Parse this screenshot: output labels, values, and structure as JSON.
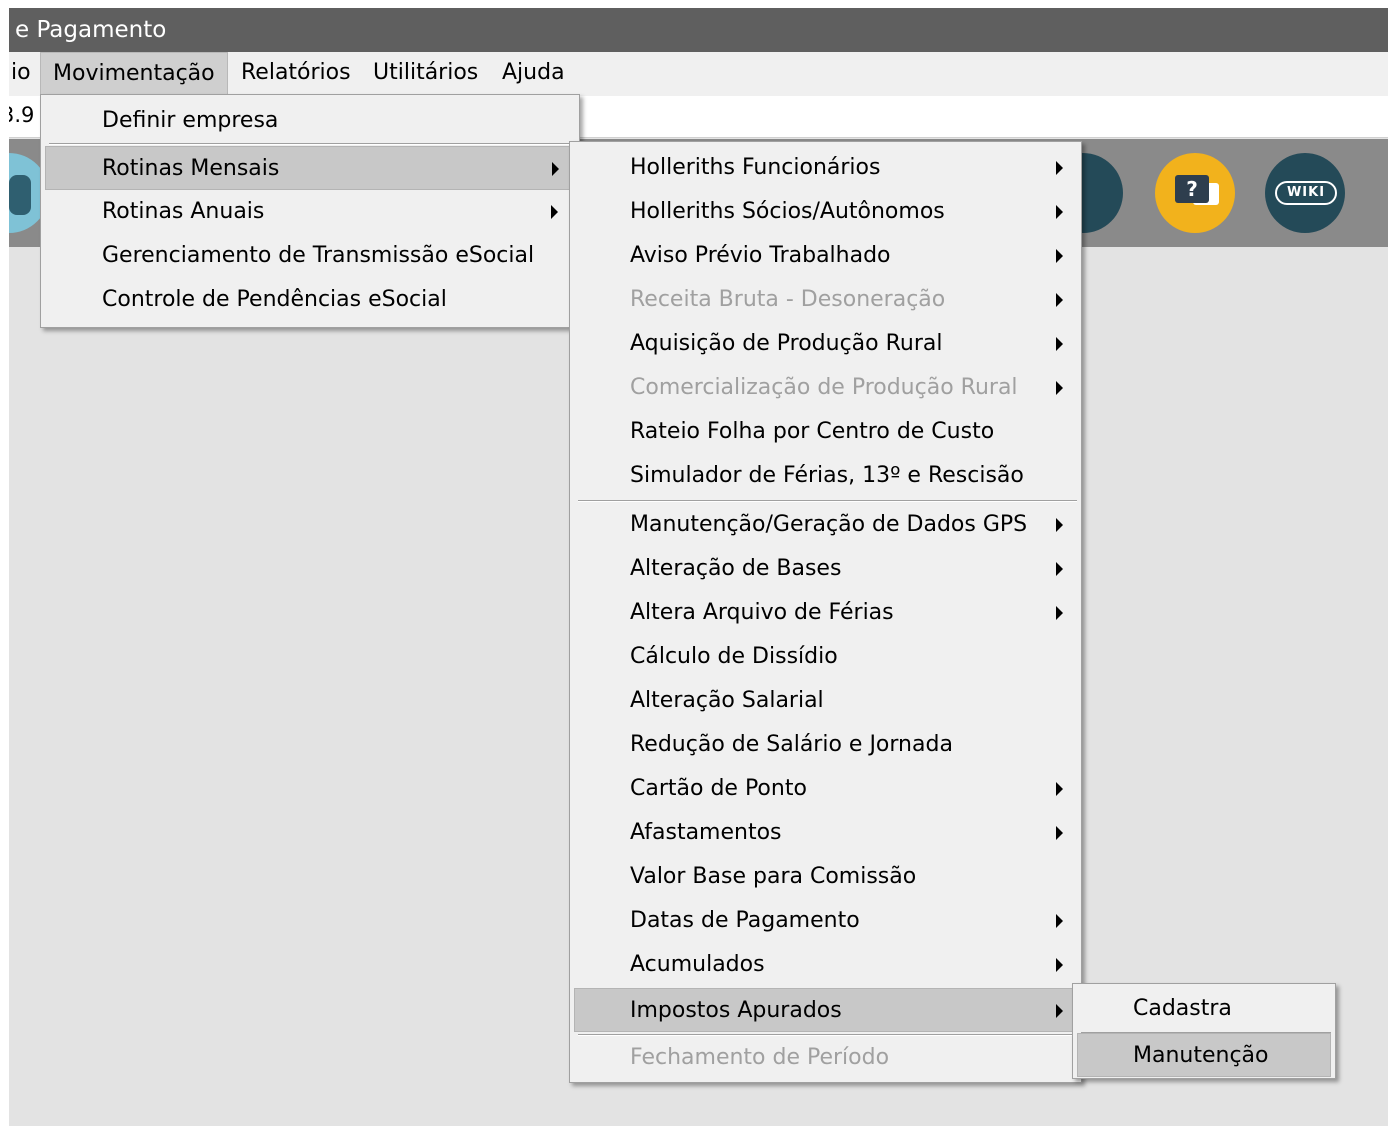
{
  "window": {
    "title": "e Pagamento"
  },
  "menubar": {
    "items": [
      {
        "label": "io"
      },
      {
        "label": "Movimentação"
      },
      {
        "label": "Relatórios"
      },
      {
        "label": "Utilitários"
      },
      {
        "label": "Ajuda"
      }
    ]
  },
  "address": {
    "value": "3.9"
  },
  "toolbar": {
    "icons": [
      "user-icon",
      "exit-icon",
      "help-chat-icon",
      "wiki-icon"
    ],
    "wiki_label": "WIKI",
    "help_glyph": "?"
  },
  "menu_movimentacao": {
    "items": [
      {
        "label": "Definir empresa"
      },
      {
        "label": "Rotinas Mensais"
      },
      {
        "label": "Rotinas Anuais"
      },
      {
        "label": "Gerenciamento de Transmissão eSocial"
      },
      {
        "label": "Controle de Pendências eSocial"
      }
    ]
  },
  "menu_rotinas_mensais": {
    "items": [
      {
        "label": "Holleriths Funcionários"
      },
      {
        "label": "Holleriths Sócios/Autônomos"
      },
      {
        "label": "Aviso Prévio Trabalhado"
      },
      {
        "label": "Receita Bruta - Desoneração"
      },
      {
        "label": "Aquisição de Produção Rural"
      },
      {
        "label": "Comercialização de Produção Rural"
      },
      {
        "label": "Rateio Folha por Centro de Custo"
      },
      {
        "label": "Simulador de Férias, 13º e Rescisão"
      },
      {
        "label": "Manutenção/Geração de Dados GPS"
      },
      {
        "label": "Alteração de Bases"
      },
      {
        "label": "Altera Arquivo de Férias"
      },
      {
        "label": "Cálculo de Dissídio"
      },
      {
        "label": "Alteração Salarial"
      },
      {
        "label": "Redução de Salário e Jornada"
      },
      {
        "label": "Cartão de Ponto"
      },
      {
        "label": "Afastamentos"
      },
      {
        "label": "Valor Base para Comissão"
      },
      {
        "label": "Datas de Pagamento"
      },
      {
        "label": "Acumulados"
      },
      {
        "label": "Impostos Apurados"
      },
      {
        "label": "Fechamento de Período"
      }
    ]
  },
  "menu_impostos_apurados": {
    "items": [
      {
        "label": "Cadastra"
      },
      {
        "label": "Manutenção"
      }
    ]
  },
  "colors": {
    "titlebar": "#5f5f5f",
    "toolbar": "#8a8a8a",
    "highlight": "#c8c8c8",
    "disabled_text": "#a0a0a0",
    "help_icon": "#f2b21c",
    "dark_icon": "#244a58"
  }
}
